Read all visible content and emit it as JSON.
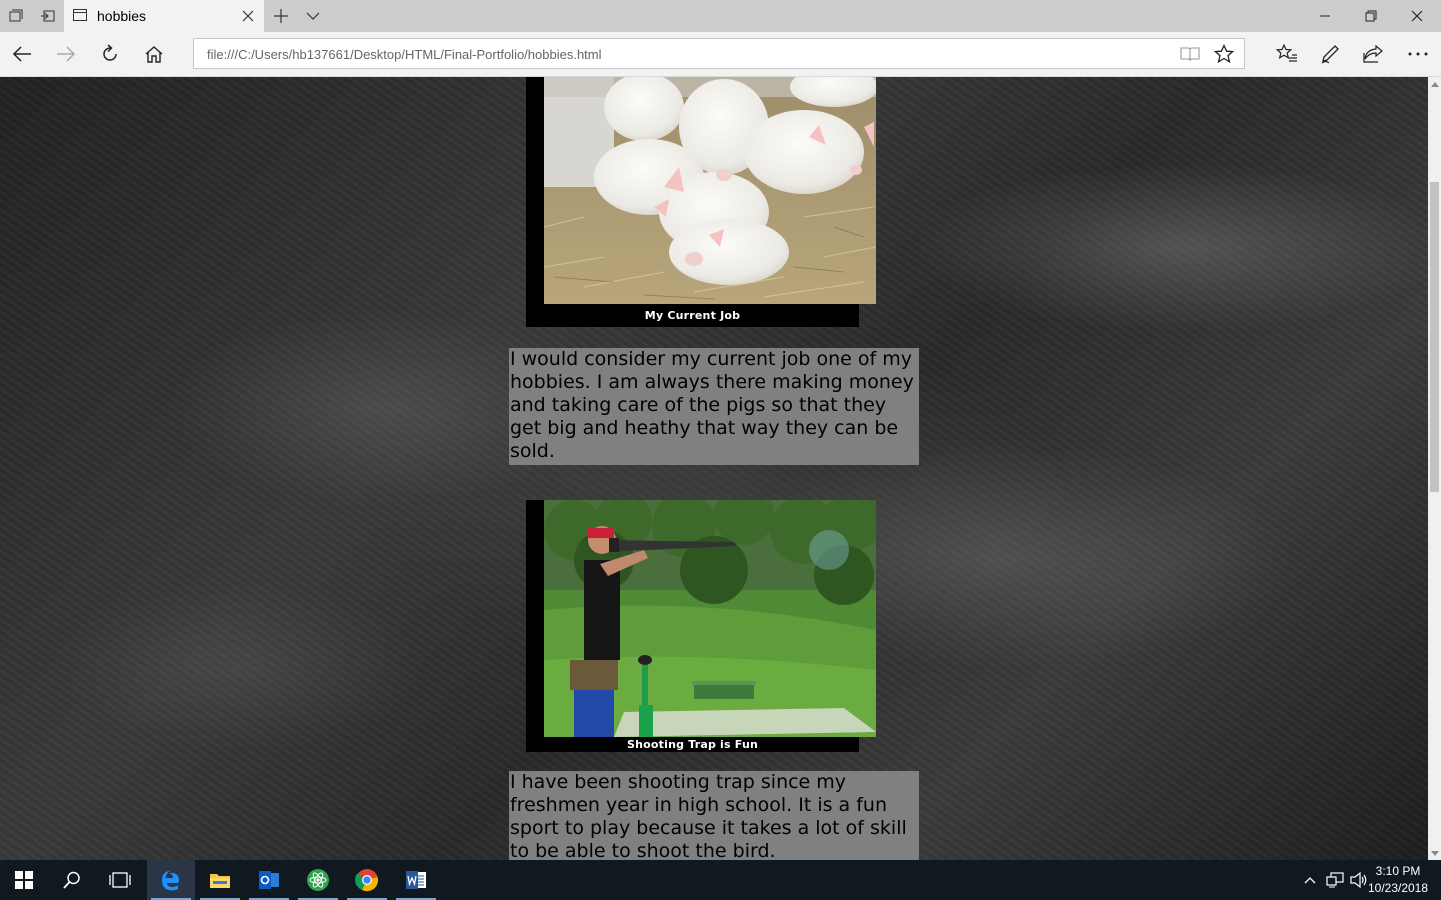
{
  "browser": {
    "tab_title": "hobbies",
    "address": "file:///C:/Users/hb137661/Desktop/HTML/Final-Portfolio/hobbies.html"
  },
  "page": {
    "figures": [
      {
        "caption": "My Current Job",
        "image_alt": "pigs-photo",
        "text": "I would consider my current job one of my hobbies. I am always there making money and taking care of the pigs so that they get big and heathy that way they can be sold."
      },
      {
        "caption": "Shooting Trap is Fun",
        "image_alt": "trap-shooting-photo",
        "text": "I have been shooting trap since my freshmen year in high school. It is a fun sport to play because it takes a lot of skill to be able to shoot the bird."
      }
    ]
  },
  "taskbar": {
    "time": "3:10 PM",
    "date": "10/23/2018",
    "apps": [
      "start-icon",
      "search-icon",
      "task-view-icon",
      "edge-icon",
      "file-explorer-icon",
      "outlook-icon",
      "atom-icon",
      "chrome-icon",
      "word-icon"
    ]
  },
  "colors": {
    "paragraph_bg": "#808080",
    "caption_bg": "#000000",
    "taskbar_bg": "#101820"
  }
}
